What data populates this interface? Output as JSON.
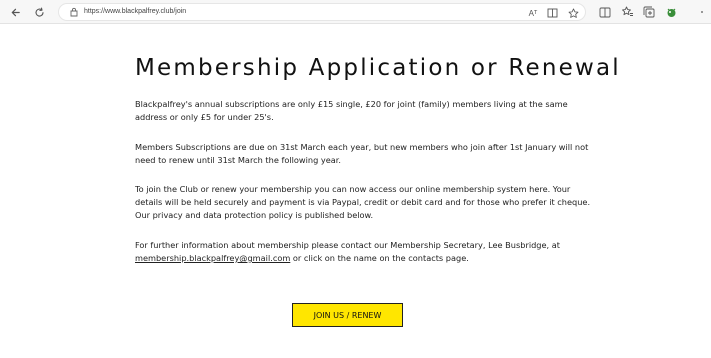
{
  "browser": {
    "url": "https://www.blackpalfrey.club/join",
    "read_aloud_icon": "Aᵀ"
  },
  "page": {
    "title": "Membership Application or Renewal",
    "paragraphs": [
      "Blackpalfrey's annual subscriptions are only £15 single, £20 for joint (family) members living at the same address or only £5 for under 25's.",
      "Members Subscriptions are due on 31st March each year, but new members who join after 1st January will not need to renew until 31st March the following year.",
      "To join the Club or renew your membership you can now access our online membership system here.  Your details will be held securely and payment is via Paypal, credit or debit card and for those who prefer it cheque. Our privacy and data protection policy is published below."
    ],
    "contact": {
      "before": "For further information about membership please contact our Membership Secretary, Lee Busbridge, at ",
      "email": "membership.blackpalfrey@gmail.com",
      "after": " or click on the name on the contacts page."
    },
    "join_button_label": "JOIN US / RENEW"
  },
  "colors": {
    "button_bg": "#ffe600",
    "text": "#222222"
  }
}
